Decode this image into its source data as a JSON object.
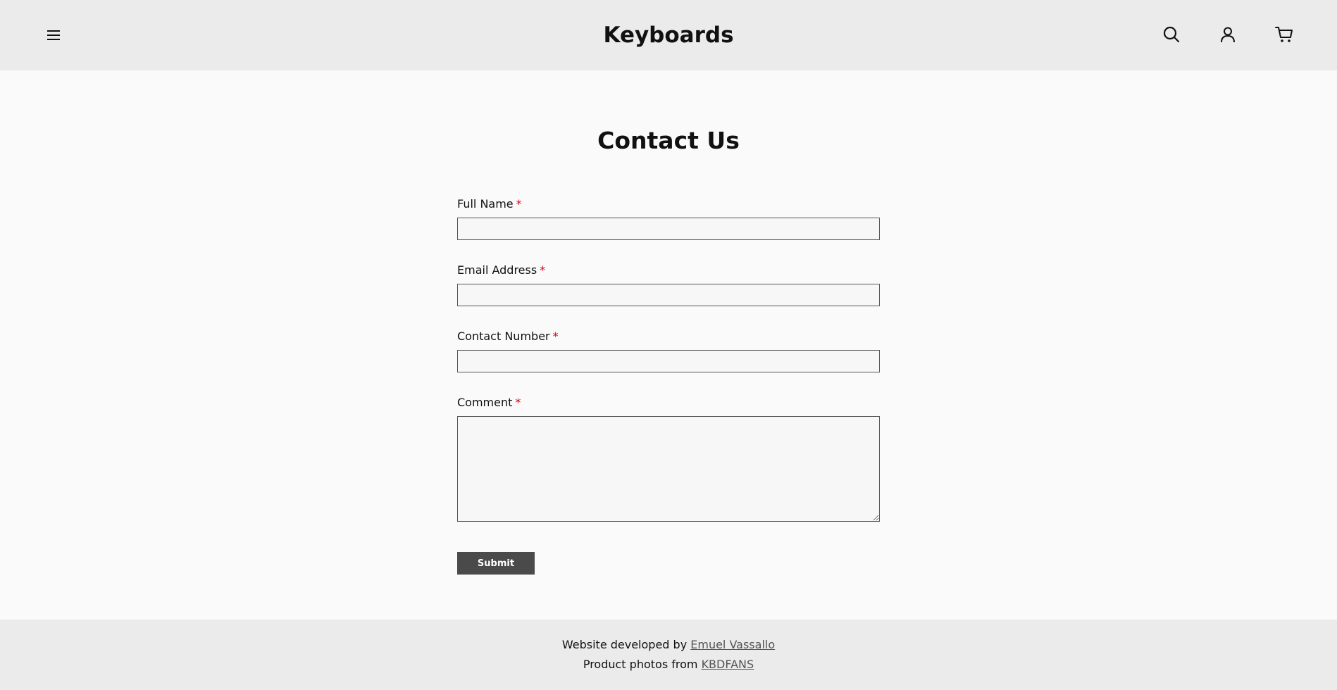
{
  "header": {
    "brand": "Keyboards",
    "icons": {
      "menu": "menu-icon",
      "search": "search-icon",
      "account": "user-icon",
      "cart": "cart-icon"
    }
  },
  "main": {
    "title": "Contact Us",
    "form": {
      "required_marker": "*",
      "full_name": {
        "label": "Full Name",
        "value": ""
      },
      "email": {
        "label": "Email Address",
        "value": ""
      },
      "contact_number": {
        "label": "Contact Number",
        "value": ""
      },
      "comment": {
        "label": "Comment",
        "value": ""
      },
      "submit_label": "Submit"
    }
  },
  "footer": {
    "line1_prefix": "Website developed by",
    "line1_link": "Emuel Vassallo",
    "line2_prefix": "Product photos from",
    "line2_link": "KBDFANS"
  },
  "colors": {
    "header_bg": "#ebebeb",
    "page_bg": "#fafafa",
    "required": "#d0021b",
    "button_bg": "#4a4a4a"
  }
}
